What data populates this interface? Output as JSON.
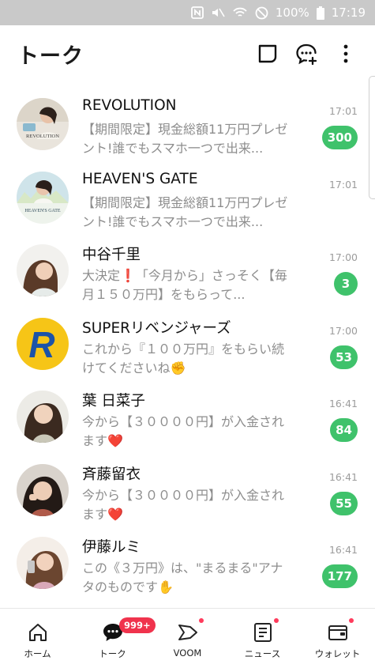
{
  "status_bar": {
    "battery": "100%",
    "time": "17:19"
  },
  "header": {
    "title": "トーク"
  },
  "chats": [
    {
      "name": "REVOLUTION",
      "message": "【期間限定】現金総額11万円プレゼント!誰でもスマホ一つで出来...",
      "time": "17:01",
      "unread": "300",
      "avatar_text": "REVOLUTION"
    },
    {
      "name": "HEAVEN'S GATE",
      "message": "【期間限定】現金総額11万円プレゼント!誰でもスマホ一つで出来...",
      "time": "17:01",
      "unread": "",
      "avatar_text": "HEAVEN'S GATE"
    },
    {
      "name": "中谷千里",
      "message": "大決定❗「今月から」さっそく【毎月１５０万円】をもらって...",
      "time": "17:00",
      "unread": "3"
    },
    {
      "name": "SUPERリベンジャーズ",
      "message": "これから『１００万円』をもらい続けてくださいね✊",
      "time": "17:00",
      "unread": "53",
      "avatar_text": "R"
    },
    {
      "name": "葉 日菜子",
      "message": "今から【３００００円】が入金されます❤️",
      "time": "16:41",
      "unread": "84"
    },
    {
      "name": "斉藤留衣",
      "message": "今から【３００００円】が入金されます❤️",
      "time": "16:41",
      "unread": "55"
    },
    {
      "name": "伊藤ルミ",
      "message": "この《３万円》は、\"まるまる\"アナタのものです✋",
      "time": "16:41",
      "unread": "177"
    }
  ],
  "nav": {
    "home": "ホーム",
    "talk": "トーク",
    "talk_badge": "999+",
    "voom": "VOOM",
    "news": "ニュース",
    "wallet": "ウォレット"
  }
}
